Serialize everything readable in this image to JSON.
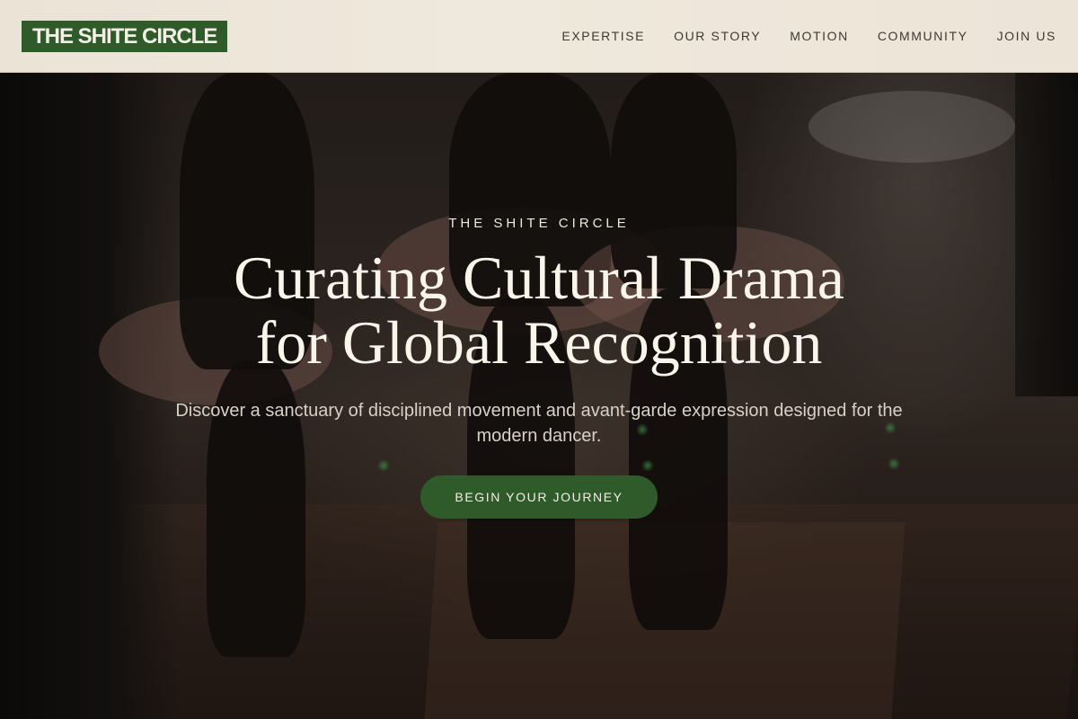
{
  "brand": {
    "logo_text": "THE SHITE CIRCLE"
  },
  "nav": {
    "items": [
      {
        "label": "EXPERTISE"
      },
      {
        "label": "OUR STORY"
      },
      {
        "label": "MOTION"
      },
      {
        "label": "COMMUNITY"
      },
      {
        "label": "JOIN US"
      }
    ]
  },
  "hero": {
    "eyebrow": "THE SHITE CIRCLE",
    "title_line1": "Curating Cultural Drama",
    "title_line2": "for Global Recognition",
    "subtitle": "Discover a sanctuary of disciplined movement and avant-garde expression designed for the modern dancer.",
    "cta_label": "BEGIN YOUR JOURNEY"
  },
  "colors": {
    "brand_green": "#2f5a2a",
    "header_bg": "#ece4d7",
    "hero_text": "#faf5ea"
  }
}
